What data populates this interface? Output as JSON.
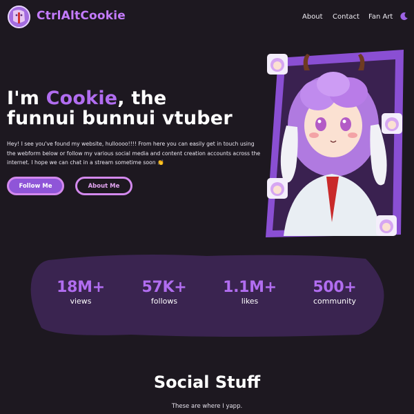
{
  "header": {
    "brand": "CtrlAltCookie",
    "nav": [
      "About",
      "Contact",
      "Fan Art"
    ],
    "theme_icon": "moon-icon"
  },
  "hero": {
    "title_prefix": "I'm ",
    "title_highlight": "Cookie",
    "title_suffix": ", the",
    "title_line2": "funnui bunnui vtuber",
    "description": "Hey! I see you've found my website, hulloooo!!!! From here you can easily get in touch using the webform below or follow my various social media and content creation accounts across the internet. I hope we can chat in a stream sometime soon 👏",
    "buttons": {
      "follow": "Follow Me",
      "about": "About Me"
    }
  },
  "stats": [
    {
      "value": "18M+",
      "label": "views"
    },
    {
      "value": "57K+",
      "label": "follows"
    },
    {
      "value": "1.1M+",
      "label": "likes"
    },
    {
      "value": "500+",
      "label": "community"
    }
  ],
  "social": {
    "title": "Social Stuff",
    "subtitle": "These are where I yapp."
  },
  "colors": {
    "background": "#1d1820",
    "accent": "#b16df0",
    "button_fill": "#8f55d8",
    "button_border": "#d389ee",
    "stats_panel": "#3a2450"
  }
}
